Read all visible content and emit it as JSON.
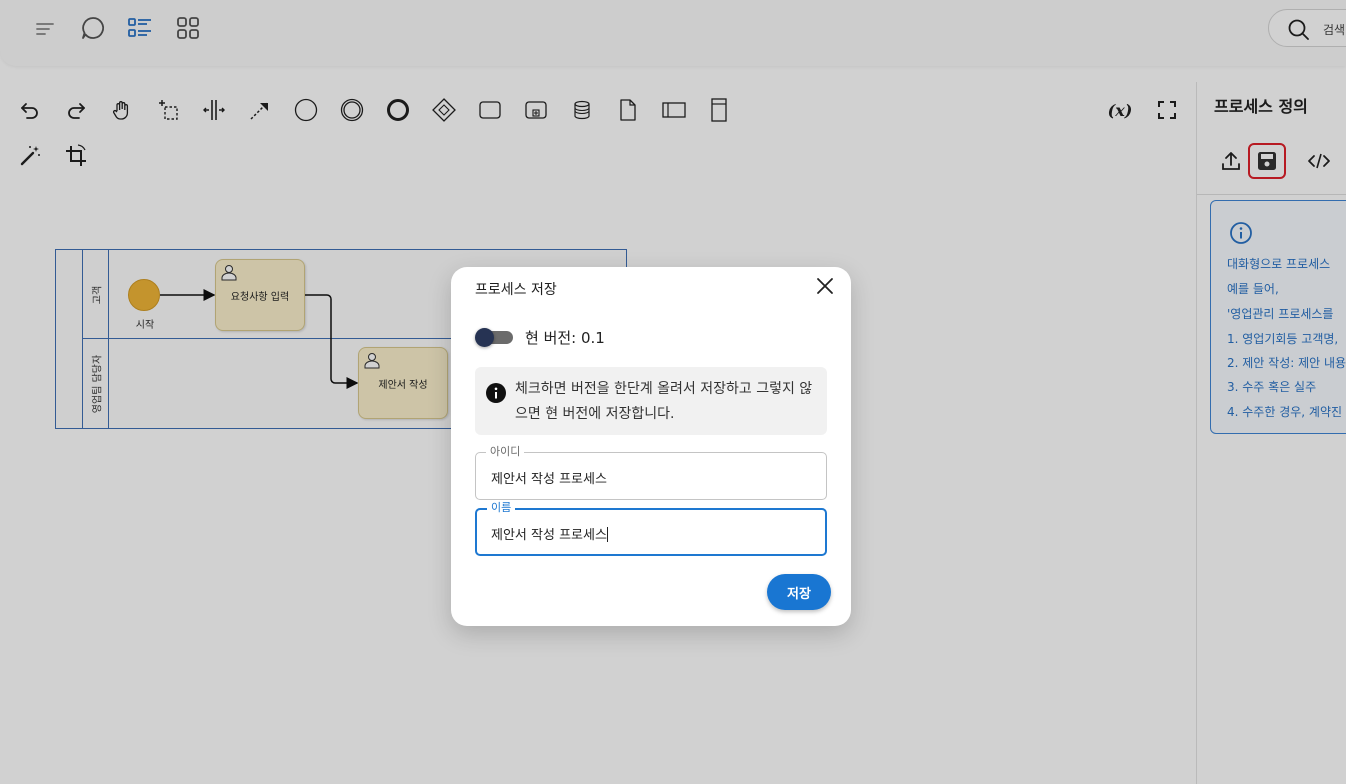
{
  "topbar": {
    "icons": [
      "menu-lines-icon",
      "chat-bubble-icon",
      "list-view-icon",
      "grid-view-icon"
    ],
    "search_label": "검색"
  },
  "toolbar": {
    "tools": [
      "undo-icon",
      "redo-icon",
      "hand-tool-icon",
      "lasso-tool-icon",
      "space-tool-icon",
      "connect-tool-icon",
      "start-event-icon",
      "intermediate-event-icon",
      "end-event-icon",
      "gateway-icon",
      "task-icon",
      "subprocess-icon",
      "data-store-icon",
      "data-object-icon",
      "pool-icon",
      "vertical-pool-icon",
      "magic-wand-icon",
      "crop-icon"
    ],
    "variables_label": "(x)"
  },
  "diagram": {
    "lanes": [
      "고객",
      "영업팀 담당자"
    ],
    "start_label": "시작",
    "tasks": [
      "요청사항 입력",
      "제안서 작성"
    ]
  },
  "right_panel": {
    "title": "프로세스 정의",
    "tabs": [
      "upload-icon",
      "save-icon",
      "code-icon"
    ],
    "info_lines": [
      "대화형으로 프로세스",
      "예를 들어,",
      "'영업관리 프로세스를",
      "1. 영업기회등 고객명,",
      "2. 제안 작성: 제안 내용",
      "3. 수주 혹은 실주",
      "4. 수주한 경우, 계약진"
    ]
  },
  "modal": {
    "title": "프로세스 저장",
    "version_label": "현 버전: 0.1",
    "version_toggle_on": false,
    "alert_text": "체크하면 버전을 한단계 올려서 저장하고 그렇지 않으면 현 버전에 저장합니다.",
    "id_field": {
      "label": "아이디",
      "value": "제안서 작성 프로세스"
    },
    "name_field": {
      "label": "이름",
      "value": "제안서 작성 프로세스"
    },
    "save_button": "저장"
  },
  "colors": {
    "accent": "#1976d2",
    "highlight": "#e0202a",
    "task_fill": "#faf0cc",
    "start_event": "#f0b537",
    "pool_border": "#3f6fb5"
  }
}
